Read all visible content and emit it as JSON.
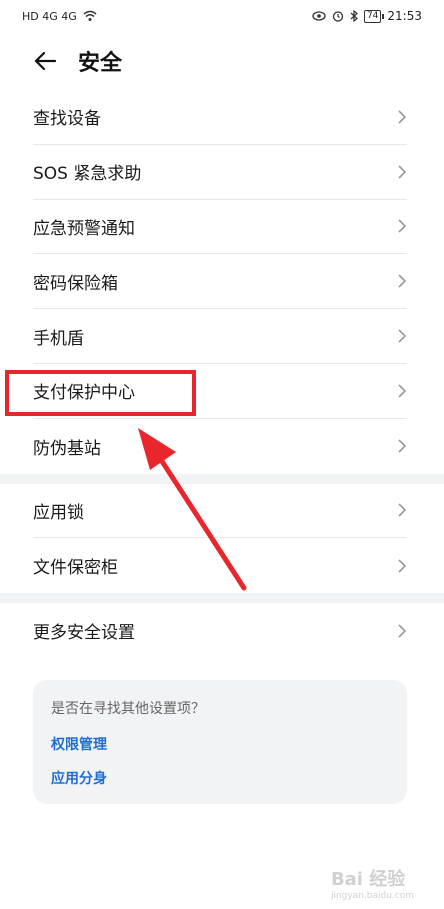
{
  "status_bar": {
    "left_icons": "HD 4G 4G",
    "battery": "74",
    "time": "21:53"
  },
  "header": {
    "title": "安全"
  },
  "section1": {
    "items": [
      {
        "label": "查找设备"
      },
      {
        "label": "SOS 紧急求助"
      },
      {
        "label": "应急预警通知"
      },
      {
        "label": "密码保险箱"
      },
      {
        "label": "手机盾"
      },
      {
        "label": "支付保护中心"
      },
      {
        "label": "防伪基站"
      }
    ]
  },
  "section2": {
    "items": [
      {
        "label": "应用锁"
      },
      {
        "label": "文件保密柜"
      }
    ]
  },
  "section3": {
    "items": [
      {
        "label": "更多安全设置"
      }
    ]
  },
  "suggestions": {
    "question": "是否在寻找其他设置项？",
    "links": [
      {
        "label": "权限管理"
      },
      {
        "label": "应用分身"
      }
    ]
  },
  "watermark": {
    "text": "Bai 经验",
    "sub": "jingyan.baidu.com"
  },
  "colors": {
    "highlight": "#e8262c",
    "link": "#1f6ed4"
  }
}
